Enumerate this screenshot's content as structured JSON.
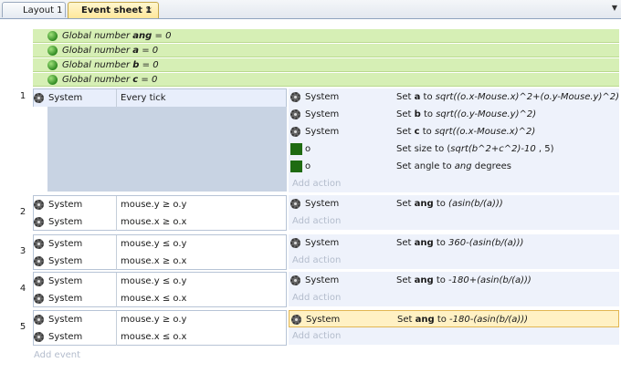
{
  "tabs": [
    {
      "label": "Layout 1"
    },
    {
      "label": "Event sheet 1",
      "close": "×",
      "active": true
    }
  ],
  "menu_arrow": "▼",
  "globals": [
    {
      "prefix": "Global number",
      "name": "ang",
      "suffix": "= 0"
    },
    {
      "prefix": "Global number",
      "name": "a",
      "suffix": "= 0"
    },
    {
      "prefix": "Global number",
      "name": "b",
      "suffix": "= 0"
    },
    {
      "prefix": "Global number",
      "name": "c",
      "suffix": "= 0"
    }
  ],
  "events": [
    {
      "num": "1",
      "conditions": [
        {
          "obj": "System",
          "text": "Every tick"
        }
      ],
      "actions": [
        {
          "obj": "System",
          "icon": "gear",
          "parts": [
            [
              "Set ",
              ""
            ],
            [
              "a",
              "b"
            ],
            [
              " to ",
              ""
            ],
            [
              "sqrt((o.x-Mouse.x)^2+(o.y-Mouse.y)^2)",
              "i"
            ]
          ]
        },
        {
          "obj": "System",
          "icon": "gear",
          "parts": [
            [
              "Set ",
              ""
            ],
            [
              "b",
              "b"
            ],
            [
              " to ",
              ""
            ],
            [
              "sqrt((o.y-Mouse.y)^2)",
              "i"
            ]
          ]
        },
        {
          "obj": "System",
          "icon": "gear",
          "parts": [
            [
              "Set ",
              ""
            ],
            [
              "c",
              "b"
            ],
            [
              " to ",
              ""
            ],
            [
              "sqrt((o.x-Mouse.x)^2)",
              "i"
            ]
          ]
        },
        {
          "obj": "o",
          "icon": "sprite",
          "parts": [
            [
              "Set size to (",
              ""
            ],
            [
              "sqrt(b^2+c^2)-10",
              "i"
            ],
            [
              " , 5)",
              ""
            ]
          ]
        },
        {
          "obj": "o",
          "icon": "sprite",
          "parts": [
            [
              "Set angle to ",
              ""
            ],
            [
              "ang",
              "i"
            ],
            [
              " degrees",
              ""
            ]
          ]
        }
      ]
    },
    {
      "num": "2",
      "conditions": [
        {
          "obj": "System",
          "text": "mouse.y ≥ o.y"
        },
        {
          "obj": "System",
          "text": "mouse.x ≥ o.x"
        }
      ],
      "actions": [
        {
          "obj": "System",
          "icon": "gear",
          "parts": [
            [
              "Set ",
              ""
            ],
            [
              "ang",
              "b"
            ],
            [
              " to ",
              ""
            ],
            [
              "(asin(b/(a)))",
              "i"
            ]
          ]
        }
      ]
    },
    {
      "num": "3",
      "conditions": [
        {
          "obj": "System",
          "text": "mouse.y ≤ o.y"
        },
        {
          "obj": "System",
          "text": "mouse.x ≥ o.x"
        }
      ],
      "actions": [
        {
          "obj": "System",
          "icon": "gear",
          "parts": [
            [
              "Set ",
              ""
            ],
            [
              "ang",
              "b"
            ],
            [
              " to ",
              ""
            ],
            [
              "360-(asin(b/(a)))",
              "i"
            ]
          ]
        }
      ]
    },
    {
      "num": "4",
      "conditions": [
        {
          "obj": "System",
          "text": "mouse.y ≤ o.y"
        },
        {
          "obj": "System",
          "text": "mouse.x ≤ o.x"
        }
      ],
      "actions": [
        {
          "obj": "System",
          "icon": "gear",
          "parts": [
            [
              "Set ",
              ""
            ],
            [
              "ang",
              "b"
            ],
            [
              " to ",
              ""
            ],
            [
              "-180+(asin(b/(a)))",
              "i"
            ]
          ]
        }
      ]
    },
    {
      "num": "5",
      "conditions": [
        {
          "obj": "System",
          "text": "mouse.y ≥ o.y"
        },
        {
          "obj": "System",
          "text": "mouse.x ≤ o.x"
        }
      ],
      "actions": [
        {
          "obj": "System",
          "icon": "gear",
          "selected": true,
          "parts": [
            [
              "Set ",
              ""
            ],
            [
              "ang",
              "b"
            ],
            [
              " to ",
              ""
            ],
            [
              "-180-(asin(b/(a)))",
              "i"
            ]
          ]
        }
      ]
    }
  ],
  "add_action": "Add action",
  "add_event": "Add event"
}
